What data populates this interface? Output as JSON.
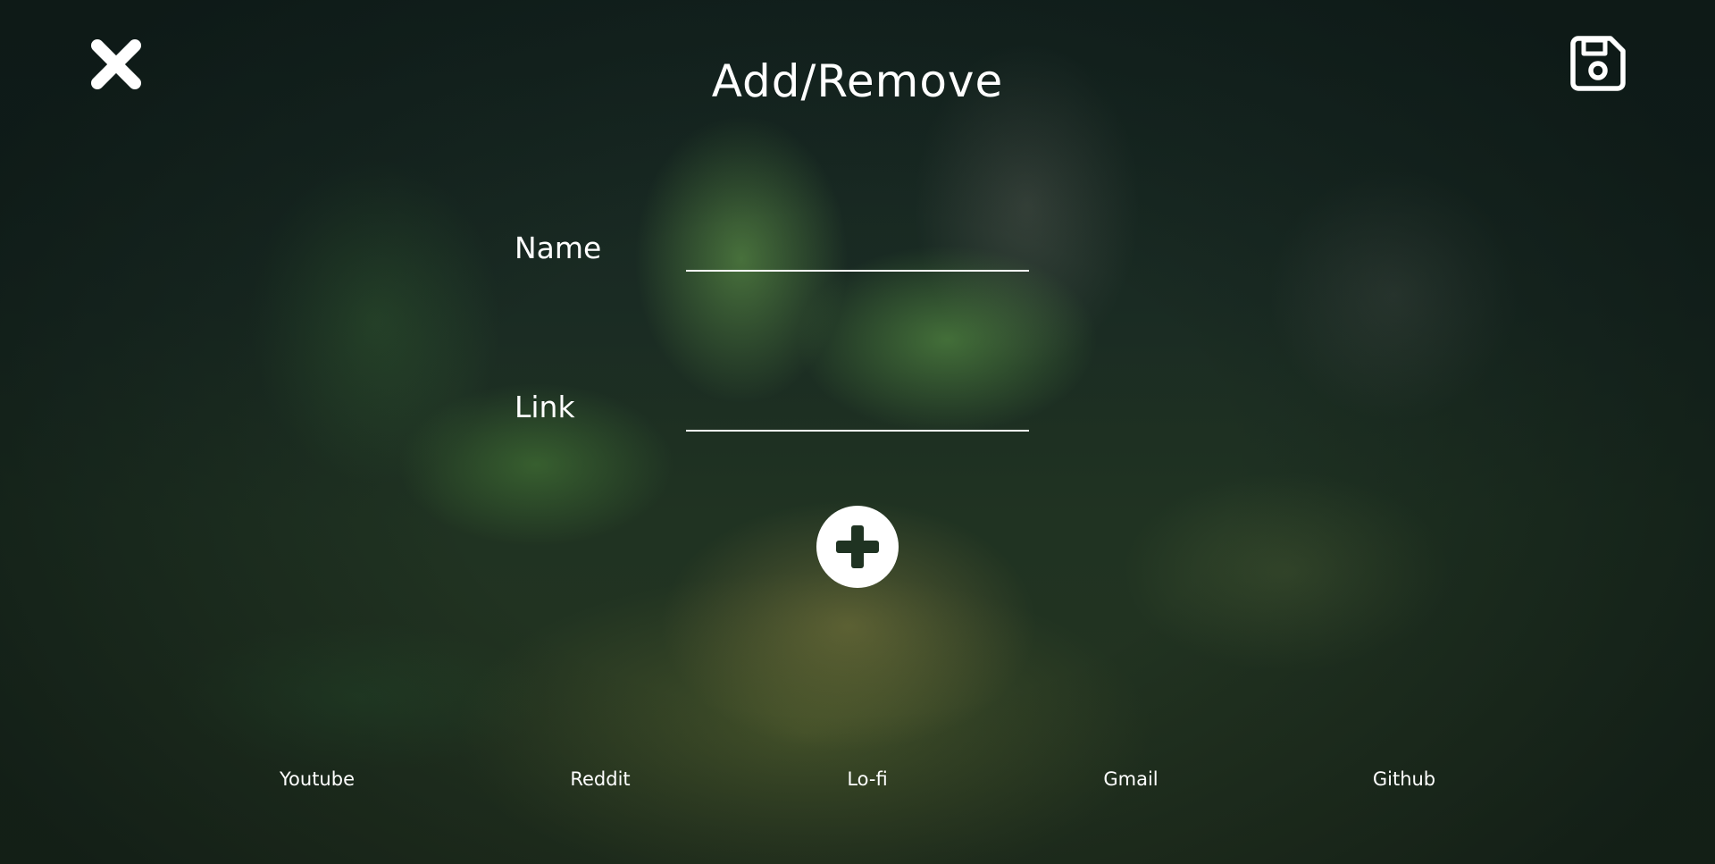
{
  "header": {
    "title": "Add/Remove",
    "close_icon": "close-icon",
    "save_icon": "save-icon"
  },
  "form": {
    "name_label": "Name",
    "name_value": "",
    "link_label": "Link",
    "link_value": "",
    "add_icon": "plus-circle-icon"
  },
  "bookmarks": [
    {
      "label": "Youtube"
    },
    {
      "label": "Reddit"
    },
    {
      "label": "Lo-fi"
    },
    {
      "label": "Gmail"
    },
    {
      "label": "Github"
    }
  ],
  "colors": {
    "text": "#ffffff",
    "background_dark": "#16241f",
    "foliage": "#5f9a45"
  }
}
